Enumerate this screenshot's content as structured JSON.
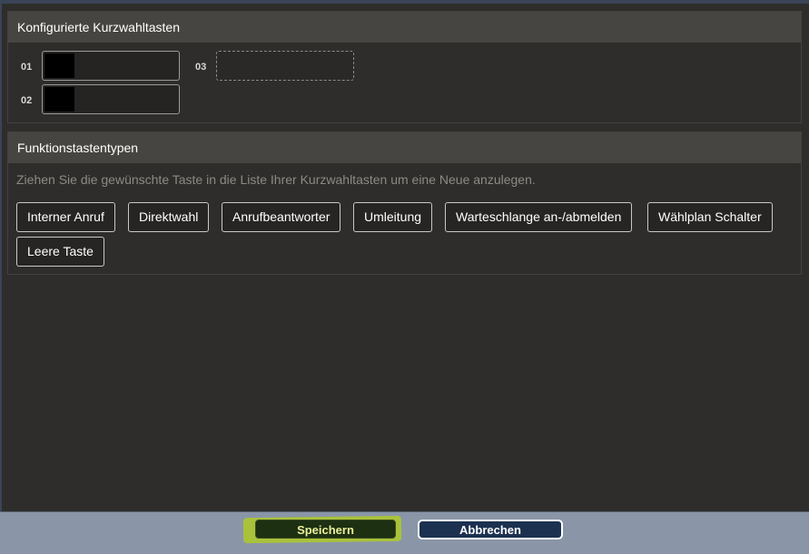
{
  "speed_dial": {
    "title": "Konfigurierte Kurzwahltasten",
    "slots": [
      {
        "number": "01",
        "state": "filled-redacted"
      },
      {
        "number": "02",
        "state": "filled-redacted"
      },
      {
        "number": "03",
        "state": "empty"
      }
    ]
  },
  "function_types": {
    "title": "Funktionstastentypen",
    "hint": "Ziehen Sie die gewünschte Taste in die Liste Ihrer Kurzwahltasten um eine Neue anzulegen.",
    "buttons": [
      "Interner Anruf",
      "Direktwahl",
      "Anrufbeantworter",
      "Umleitung",
      "Warteschlange an-/abmelden",
      "Wählplan Schalter",
      "Leere Taste"
    ]
  },
  "footer": {
    "save_label": "Speichern",
    "cancel_label": "Abbrechen"
  },
  "colors": {
    "background": "#2e2d2b",
    "panel_header": "#474541",
    "footer": "#8a96a8",
    "save_highlight": "#a9c23c",
    "save_button": "#1d3012",
    "cancel_button": "#1c3150"
  }
}
